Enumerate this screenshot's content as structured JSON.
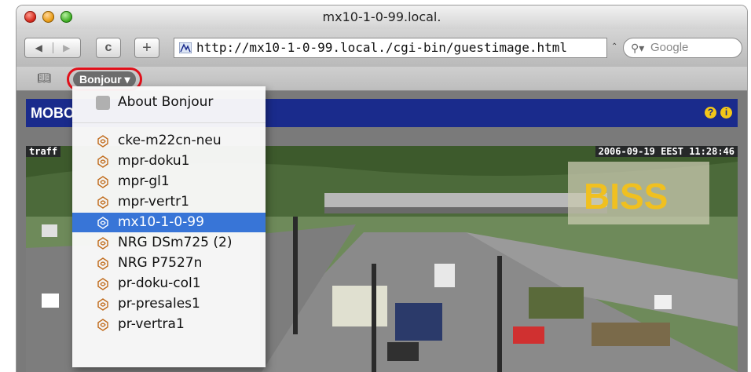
{
  "window": {
    "title": "mx10-1-0-99.local."
  },
  "toolbar": {
    "back_label": "◀",
    "forward_label": "▶",
    "reload_label": "c",
    "add_label": "+",
    "url": "http://mx10-1-0-99.local./cgi-bin/guestimage.html",
    "search_placeholder": "Google"
  },
  "bookmarks": {
    "bonjour_label": "Bonjour ▾"
  },
  "page": {
    "header_text": "MOBO",
    "overlay_left": "traff",
    "overlay_right": "2006-09-19 EEST 11:28:46",
    "logo_text": "BISS"
  },
  "bonjour_menu": {
    "about_label": "About Bonjour",
    "items": [
      {
        "label": "cke-m22cn-neu",
        "selected": false
      },
      {
        "label": "mpr-doku1",
        "selected": false
      },
      {
        "label": "mpr-gl1",
        "selected": false
      },
      {
        "label": "mpr-vertr1",
        "selected": false
      },
      {
        "label": "mx10-1-0-99",
        "selected": true
      },
      {
        "label": "NRG DSm725 (2)",
        "selected": false
      },
      {
        "label": "NRG P7527n",
        "selected": false
      },
      {
        "label": "pr-doku-col1",
        "selected": false
      },
      {
        "label": "pr-presales1",
        "selected": false
      },
      {
        "label": "pr-vertra1",
        "selected": false
      }
    ]
  },
  "colors": {
    "selection": "#3875d7",
    "highlight_ring": "#e0101a",
    "page_header": "#1a2b8c"
  }
}
